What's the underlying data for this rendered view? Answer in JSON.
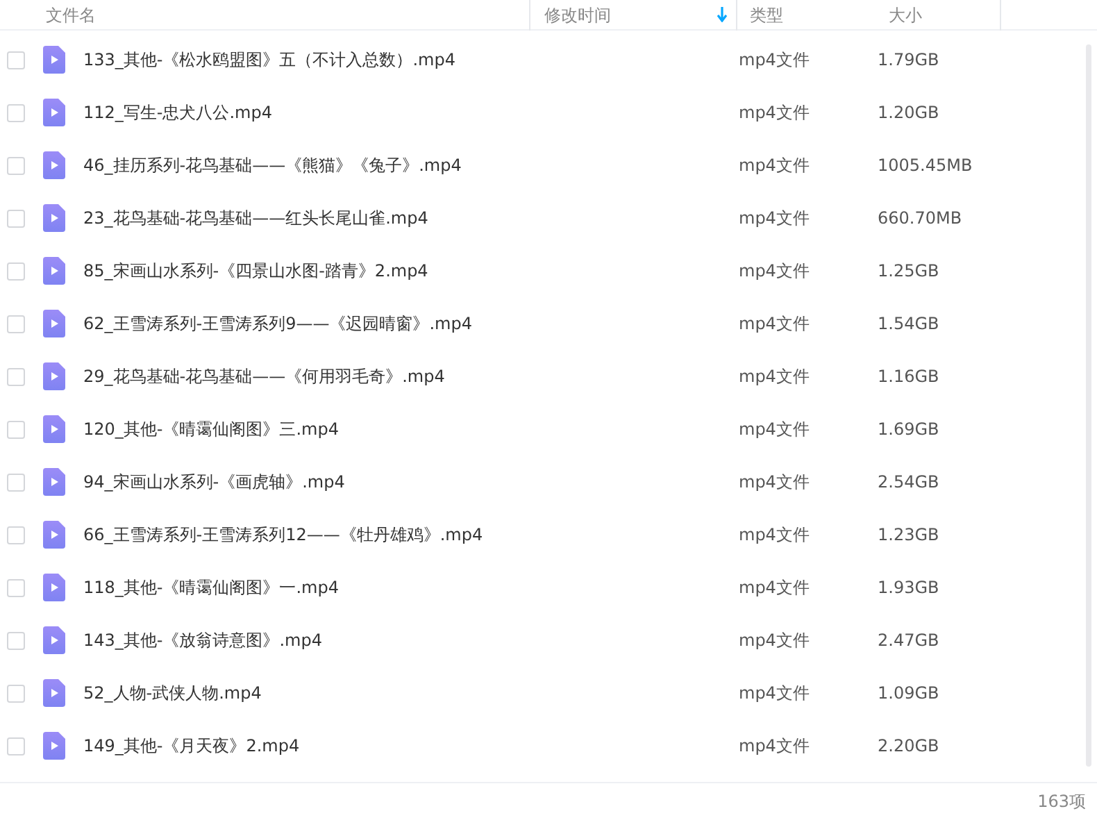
{
  "columns": [
    {
      "label": "文件名"
    },
    {
      "label": "修改时间",
      "sorted": true
    },
    {
      "label": "类型"
    },
    {
      "label": "大小"
    }
  ],
  "files": [
    {
      "name": "133_其他-《松水鸥盟图》五（不计入总数）.mp4",
      "type": "mp4文件",
      "size": "1.79GB",
      "checked": false
    },
    {
      "name": "112_写生-忠犬八公.mp4",
      "type": "mp4文件",
      "size": "1.20GB",
      "checked": false
    },
    {
      "name": "46_挂历系列-花鸟基础——《熊猫》《兔子》.mp4",
      "type": "mp4文件",
      "size": "1005.45MB",
      "checked": false
    },
    {
      "name": "23_花鸟基础-花鸟基础——红头长尾山雀.mp4",
      "type": "mp4文件",
      "size": "660.70MB",
      "checked": false
    },
    {
      "name": "85_宋画山水系列-《四景山水图-踏青》2.mp4",
      "type": "mp4文件",
      "size": "1.25GB",
      "checked": false
    },
    {
      "name": "62_王雪涛系列-王雪涛系列9——《迟园晴窗》.mp4",
      "type": "mp4文件",
      "size": "1.54GB",
      "checked": false
    },
    {
      "name": "29_花鸟基础-花鸟基础——《何用羽毛奇》.mp4",
      "type": "mp4文件",
      "size": "1.16GB",
      "checked": false
    },
    {
      "name": "120_其他-《晴霭仙阁图》三.mp4",
      "type": "mp4文件",
      "size": "1.69GB",
      "checked": false
    },
    {
      "name": "94_宋画山水系列-《画虎轴》.mp4",
      "type": "mp4文件",
      "size": "2.54GB",
      "checked": false
    },
    {
      "name": "66_王雪涛系列-王雪涛系列12——《牡丹雄鸡》.mp4",
      "type": "mp4文件",
      "size": "1.23GB",
      "checked": false
    },
    {
      "name": "118_其他-《晴霭仙阁图》一.mp4",
      "type": "mp4文件",
      "size": "1.93GB",
      "checked": false
    },
    {
      "name": "143_其他-《放翁诗意图》.mp4",
      "type": "mp4文件",
      "size": "2.47GB",
      "checked": false
    },
    {
      "name": "52_人物-武侠人物.mp4",
      "type": "mp4文件",
      "size": "1.09GB",
      "checked": false
    },
    {
      "name": "149_其他-《月天夜》2.mp4",
      "type": "mp4文件",
      "size": "2.20GB",
      "checked": false
    }
  ],
  "status_bar": {
    "count": "163项"
  }
}
